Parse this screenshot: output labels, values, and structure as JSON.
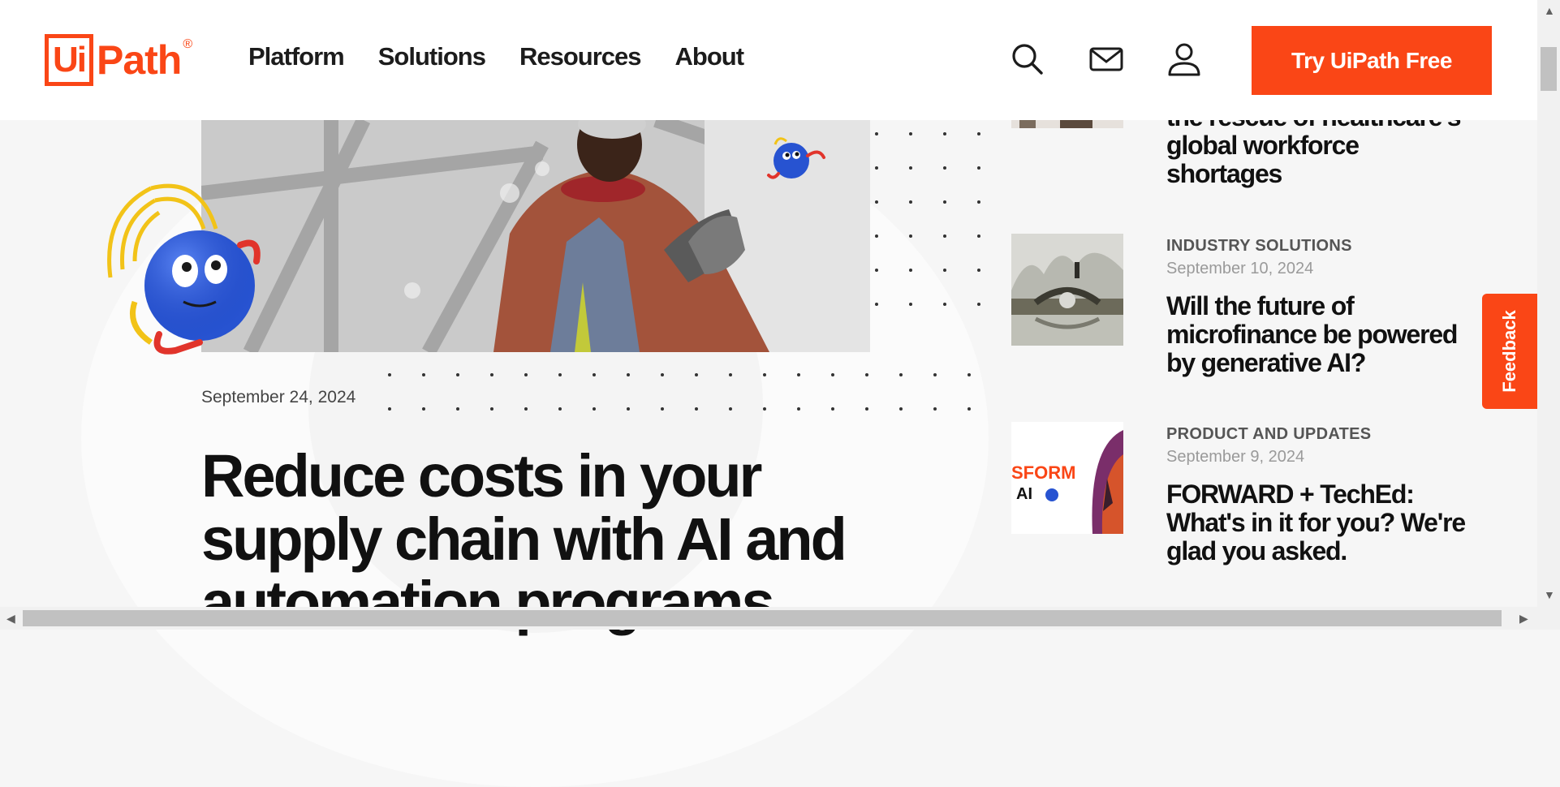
{
  "colors": {
    "brand": "#fa4616",
    "text": "#1c1c1c",
    "muted": "#9a9a9a"
  },
  "header": {
    "logo_box": "Ui",
    "logo_rest": "Path",
    "logo_reg": "®",
    "nav": [
      "Platform",
      "Solutions",
      "Resources",
      "About"
    ],
    "icons": [
      "search-icon",
      "mail-icon",
      "user-icon"
    ],
    "cta": "Try UiPath Free"
  },
  "hero": {
    "date": "September 24, 2024",
    "title_lines": [
      "Reduce costs in your",
      "supply chain with AI and",
      "automation programs"
    ]
  },
  "sidebar": {
    "items": [
      {
        "category": "",
        "date": "",
        "title_lines": [
          "the rescue of healthcare's",
          "global workforce",
          "shortages"
        ]
      },
      {
        "category": "INDUSTRY SOLUTIONS",
        "date": "September 10, 2024",
        "title_lines": [
          "Will the future of",
          "microfinance be powered",
          "by generative AI?"
        ]
      },
      {
        "category": "PRODUCT AND UPDATES",
        "date": "September 9, 2024",
        "title_lines": [
          "FORWARD + TechEd:",
          "What's in it for you? We're",
          "glad you asked."
        ]
      }
    ],
    "thumb3_text": [
      "SFORM",
      "AI"
    ]
  },
  "feedback": "Feedback"
}
